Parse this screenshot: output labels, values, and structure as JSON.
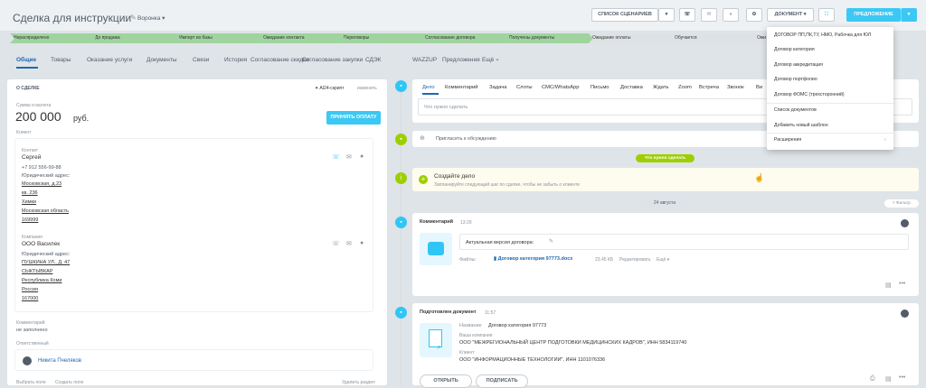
{
  "header": {
    "title": "Сделка для инструкции",
    "edit_icon": "pencil-icon",
    "funnel": "Воронка",
    "scenarios_button": "СПИСОК СЦЕНАРИЕВ",
    "document_button": "ДОКУМЕНТ",
    "offer_button": "ПРЕДЛОЖЕНИЕ"
  },
  "stages": [
    {
      "label": "Нераспределено",
      "color": "#9fd49f"
    },
    {
      "label": "До продажа",
      "color": "#9fd49f"
    },
    {
      "label": "Импорт из базы",
      "color": "#9fd49f"
    },
    {
      "label": "Ожидание контакта",
      "color": "#9fd49f"
    },
    {
      "label": "Переговоры",
      "color": "#9fd49f"
    },
    {
      "label": "Согласование договора",
      "color": "#9fd49f"
    },
    {
      "label": "Получены документы",
      "color": "#9fd49f"
    },
    {
      "label": "Ожидание оплаты",
      "color": "#dfe2e5"
    },
    {
      "label": "Обучается",
      "color": "#dfe2e5"
    },
    {
      "label": "Ожи",
      "color": "#dfe2e5"
    }
  ],
  "tabs": [
    "Общие",
    "Товары",
    "Оказание услуги",
    "Документы",
    "Связи",
    "История",
    "Согласование скидки",
    "Согласование закупки",
    "СДЭК",
    "WAZZUP",
    "Предложения",
    "Ещё"
  ],
  "deal": {
    "section_title": "О СДЕЛКЕ",
    "script": "AI24-скрипт",
    "edit": "изменить",
    "amount_label": "Сумма и валюта",
    "amount": "200 000",
    "currency": "руб.",
    "pay_button": "ПРИНЯТЬ ОПЛАТУ",
    "client_label": "Клиент",
    "contact_label": "Контакт",
    "contact_name": "Сергей",
    "contact_phone": "+7 912 556-99-88",
    "contact_addr_label": "Юридический адрес:",
    "contact_addr": [
      "Московская, д.23",
      "кв. 236",
      "Химки",
      "Московская область",
      "169999"
    ],
    "company_label": "Компания",
    "company_name": "ООО Василек",
    "company_addr_label": "Юридический адрес:",
    "company_addr": [
      "ПУШКИНА УЛ., Д. 47",
      "СЫКТЫВКАР",
      "Республика Коми",
      "Россия",
      "167000"
    ],
    "comment_label": "Комментарий",
    "comment_value": "не заполнено",
    "responsible_label": "Ответственный",
    "responsible_name": "Никита Пчеляков",
    "bottom_left": "Выбрать поле",
    "bottom_mid": "Создать поле",
    "bottom_right": "Удалить раздел"
  },
  "activity": {
    "tabs": [
      "Дело",
      "Комментарий",
      "Задача",
      "Слоты",
      "СМС/WhatsApp",
      "Письмо",
      "Доставка",
      "Ждать",
      "Zoom",
      "Встреча",
      "Звонок",
      "Ви"
    ],
    "placeholder": "Что нужно сделать",
    "invite": "Пригласить к обсуждению",
    "todo_badge": "Что нужно сделать",
    "create_title": "Создайте дело",
    "create_sub": "Запланируйте следующий шаг по сделке, чтобы не забыть о клиенте",
    "date_badge": "24 августа",
    "filter": "Фильтр",
    "comment_title": "Комментарий",
    "comment_time": "13:29",
    "comment_text": "Актуальная версия договора:",
    "files_label": "Файлы:",
    "file_name": "Договор категория 97773.docx",
    "file_size": "23.45 КБ",
    "file_edit": "Редактировать",
    "file_more": "Ещё",
    "doc_title": "Подготовлен документ",
    "doc_time": "11:57",
    "doc_name_label": "Название",
    "doc_name": "Договор категория 97773",
    "doc_company_label": "Ваша компания",
    "doc_company": "ООО \"МЕЖРЕГИОНАЛЬНЫЙ ЦЕНТР ПОДГОТОВКИ МЕДИЦИНСКИХ КАДРОВ\", ИНН 5834119740",
    "doc_client_label": "Клиент",
    "doc_client": "ООО \"ИНФОРМАЦИОННЫЕ ТЕХНОЛОГИИ\", ИНН 1101076336",
    "open_button": "ОТКРЫТЬ",
    "sign_button": "ПОДПИСАТЬ"
  },
  "document_menu": {
    "items": [
      "ДОГОВОР ПП,ПК,ТУ, НМО, Рабочка для ЮЛ",
      "Договор категория",
      "Договор аккредитация",
      "Договор портфолио",
      "Договор ФОМС (трехсторонний)",
      "Список документов",
      "Добавить новый шаблон",
      "Расширения"
    ]
  }
}
